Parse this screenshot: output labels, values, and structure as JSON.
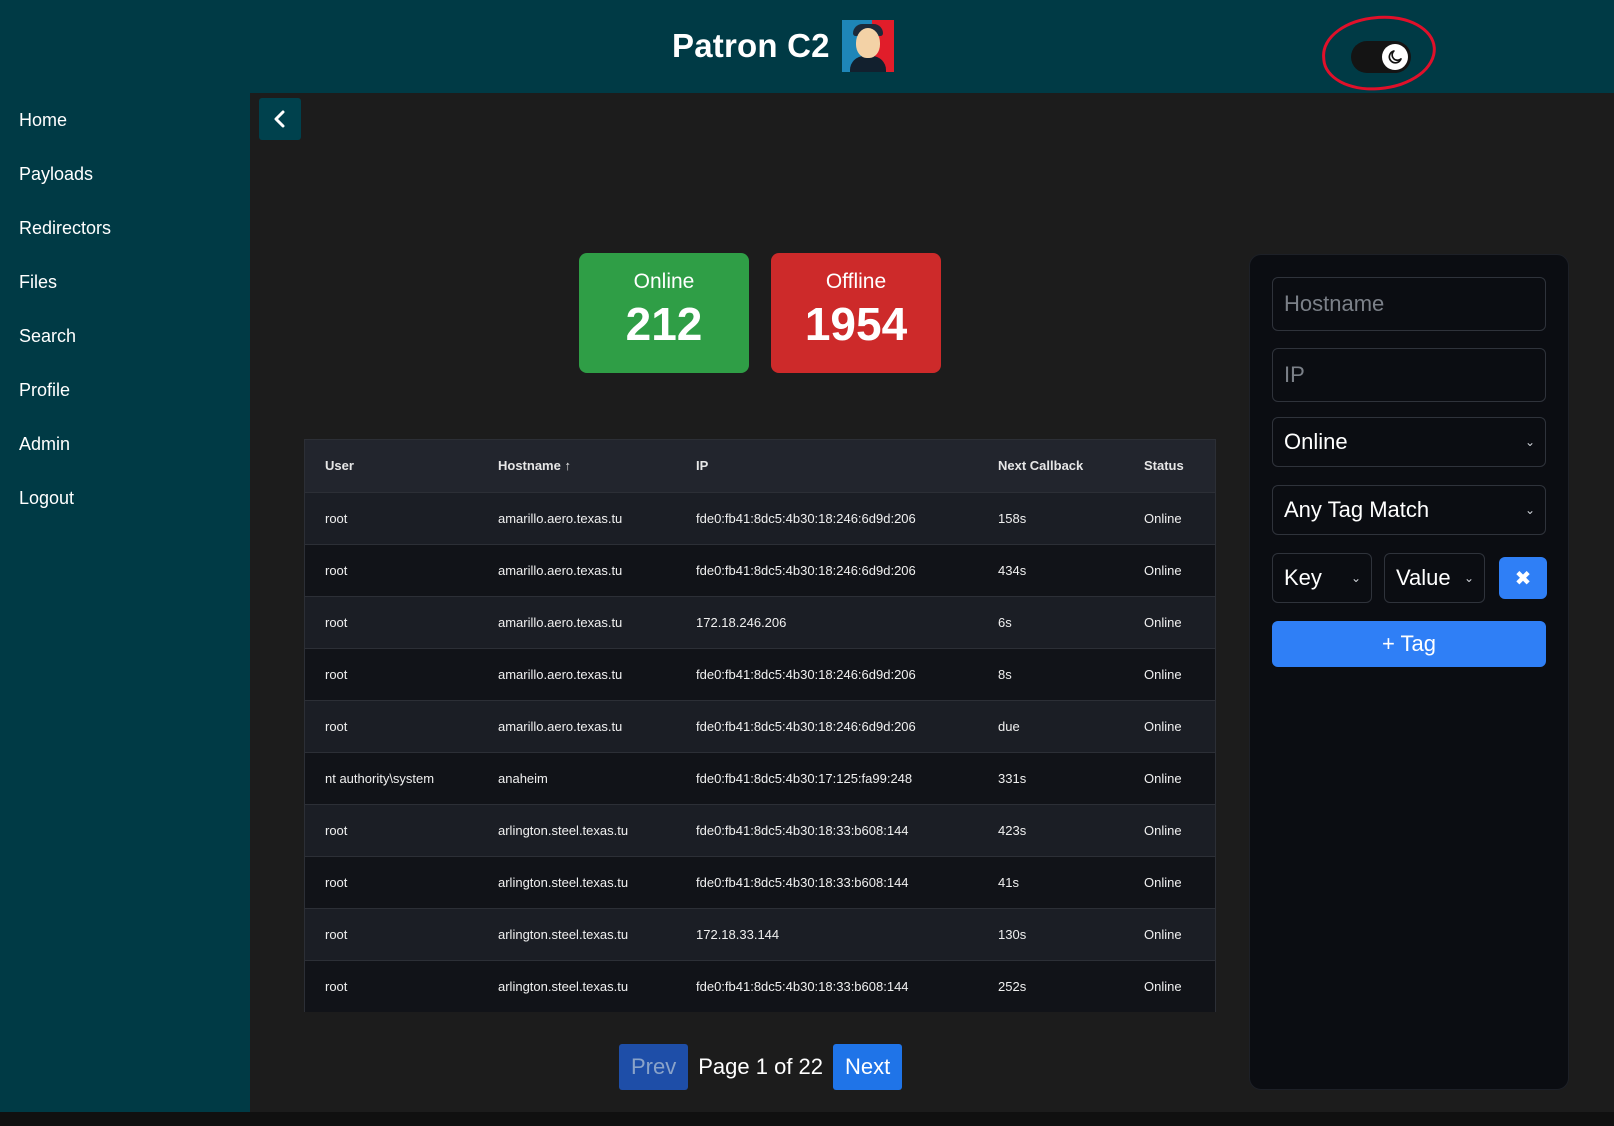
{
  "header": {
    "title": "Patron C2"
  },
  "sidebar": {
    "items": [
      {
        "label": "Home"
      },
      {
        "label": "Payloads"
      },
      {
        "label": "Redirectors"
      },
      {
        "label": "Files"
      },
      {
        "label": "Search"
      },
      {
        "label": "Profile"
      },
      {
        "label": "Admin"
      },
      {
        "label": "Logout"
      }
    ]
  },
  "stats": {
    "online": {
      "label": "Online",
      "value": "212"
    },
    "offline": {
      "label": "Offline",
      "value": "1954"
    }
  },
  "table": {
    "headers": [
      "User",
      "Hostname ↑",
      "IP",
      "Next Callback",
      "Status"
    ],
    "rows": [
      [
        "root",
        "amarillo.aero.texas.tu",
        "fde0:fb41:8dc5:4b30:18:246:6d9d:206",
        "158s",
        "Online"
      ],
      [
        "root",
        "amarillo.aero.texas.tu",
        "fde0:fb41:8dc5:4b30:18:246:6d9d:206",
        "434s",
        "Online"
      ],
      [
        "root",
        "amarillo.aero.texas.tu",
        "172.18.246.206",
        "6s",
        "Online"
      ],
      [
        "root",
        "amarillo.aero.texas.tu",
        "fde0:fb41:8dc5:4b30:18:246:6d9d:206",
        "8s",
        "Online"
      ],
      [
        "root",
        "amarillo.aero.texas.tu",
        "fde0:fb41:8dc5:4b30:18:246:6d9d:206",
        "due",
        "Online"
      ],
      [
        "nt authority\\system",
        "anaheim",
        "fde0:fb41:8dc5:4b30:17:125:fa99:248",
        "331s",
        "Online"
      ],
      [
        "root",
        "arlington.steel.texas.tu",
        "fde0:fb41:8dc5:4b30:18:33:b608:144",
        "423s",
        "Online"
      ],
      [
        "root",
        "arlington.steel.texas.tu",
        "fde0:fb41:8dc5:4b30:18:33:b608:144",
        "41s",
        "Online"
      ],
      [
        "root",
        "arlington.steel.texas.tu",
        "172.18.33.144",
        "130s",
        "Online"
      ],
      [
        "root",
        "arlington.steel.texas.tu",
        "fde0:fb41:8dc5:4b30:18:33:b608:144",
        "252s",
        "Online"
      ]
    ]
  },
  "pagination": {
    "prev": "Prev",
    "info": "Page 1 of 22",
    "next": "Next"
  },
  "filters": {
    "hostname_placeholder": "Hostname",
    "ip_placeholder": "IP",
    "status_value": "Online",
    "tag_match_value": "Any Tag Match",
    "key_value": "Key",
    "value_value": "Value",
    "add_tag": "+ Tag"
  },
  "icons": {
    "theme_toggle": "moon-icon",
    "back": "chevron-left-icon",
    "remove": "close-icon"
  },
  "colors": {
    "header_bg": "#003a45",
    "online": "#2f9e46",
    "offline": "#cd2a2a",
    "accent": "#2f7ff6"
  }
}
